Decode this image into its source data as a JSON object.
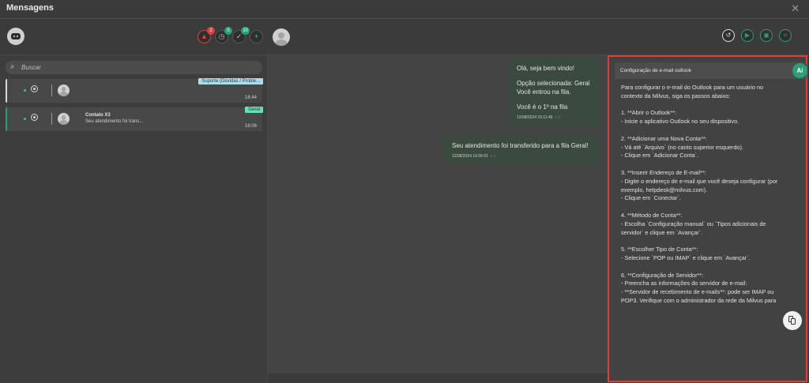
{
  "window": {
    "title": "Mensagens",
    "close_icon": "close-icon"
  },
  "left": {
    "toolbar": [
      {
        "icon": "alert-icon",
        "badge": "2",
        "badge_color": "#d24545"
      },
      {
        "icon": "clock-icon",
        "badge": "5",
        "badge_color": "#2e9e74"
      },
      {
        "icon": "check-icon",
        "badge": "10",
        "badge_color": "#2e9e74"
      },
      {
        "icon": "plus-icon",
        "badge": ""
      }
    ],
    "search": {
      "placeholder": "Buscar"
    },
    "chats": [
      {
        "tag": "Suporte (Dúvidas / Proble...",
        "name": "",
        "preview": "",
        "time": "16:44"
      },
      {
        "tag": "Geral",
        "name": "Contato X3",
        "preview": "Seu atendimento foi trans...",
        "time": "16:06"
      }
    ]
  },
  "messages": [
    {
      "lines": [
        "Olá, seja bem vindo!",
        "",
        "Opção selecionada: Geral",
        "Você entrou na fila.",
        "",
        "Você é o 1º na fila"
      ],
      "timestamp": "12/08/2024 15:11:46"
    },
    {
      "lines": [
        "Seu atendimento foi transferido para a fila Geral!"
      ],
      "timestamp": "12/08/2024 16:06:01"
    }
  ],
  "ai_panel": {
    "title": "Configuração de e-mail outlook",
    "logo": "Ai",
    "lines": [
      "Para configurar o e-mail do Outlook para um usuário no",
      "contexto da Milvus, siga os passos abaixo:",
      "",
      "1. **Abrir o Outlook**:",
      "- Inicie o aplicativo Outlook no seu dispositivo.",
      "",
      "2. **Adicionar uma Nova Conta**:",
      "- Vá até `Arquivo` (no canto superior esquerdo).",
      "- Clique em `Adicionar Conta`.",
      "",
      "3. **Inserir Endereço de E-mail**:",
      "- Digite o endereço de e-mail que você deseja configurar (por",
      "exemplo, helpdesk@milvus.com).",
      "- Clique em `Conectar`.",
      "",
      "4. **Método de Conta**:",
      "- Escolha `Configuração manual` ou `Tipos adicionais de",
      "servidor` e clique em `Avançar`.",
      "",
      "5. **Escolher Tipo de Conta**:",
      "- Selecione `POP ou IMAP` e clique em `Avançar`.",
      "",
      "6. **Configuração de Servidor**:",
      "- Preencha as informações do servidor de e-mail:",
      "- **Servidor de recebimento de e-mails**: pode ser IMAP ou",
      "POP3. Verifique com o administrador da rede da Milvus para"
    ],
    "copy_icon": "copy-icon",
    "highlight_color": "#e23b3b"
  },
  "header_right_icons": [
    "history-icon",
    "play-icon",
    "window-icon",
    "tag-icon"
  ],
  "colors": {
    "accent": "#2e9e74",
    "alert": "#d24545"
  }
}
